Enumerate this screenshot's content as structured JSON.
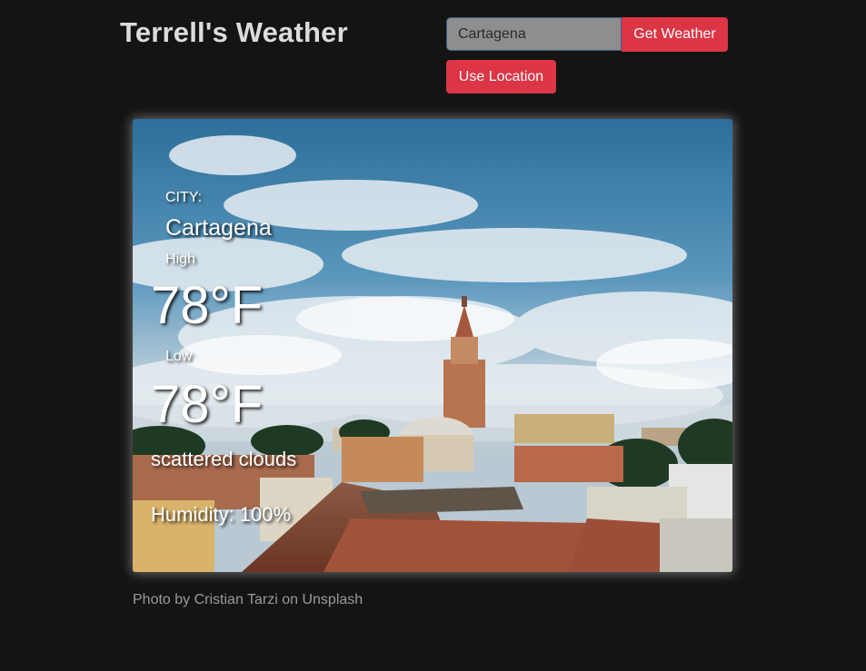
{
  "header": {
    "title": "Terrell's Weather",
    "search_value": "Cartagena",
    "get_weather_label": "Get Weather",
    "use_location_label": "Use Location"
  },
  "weather": {
    "city_label": "CITY:",
    "city": "Cartagena",
    "high_label": "High",
    "high": "78°F",
    "low_label": "Low",
    "low": "78°F",
    "description": "scattered clouds",
    "humidity": "Humidity: 100%"
  },
  "credit": "Photo by Cristian Tarzi on Unsplash",
  "colors": {
    "background": "#141414",
    "accent": "#dc3545",
    "input_bg": "#8e8e8e"
  }
}
